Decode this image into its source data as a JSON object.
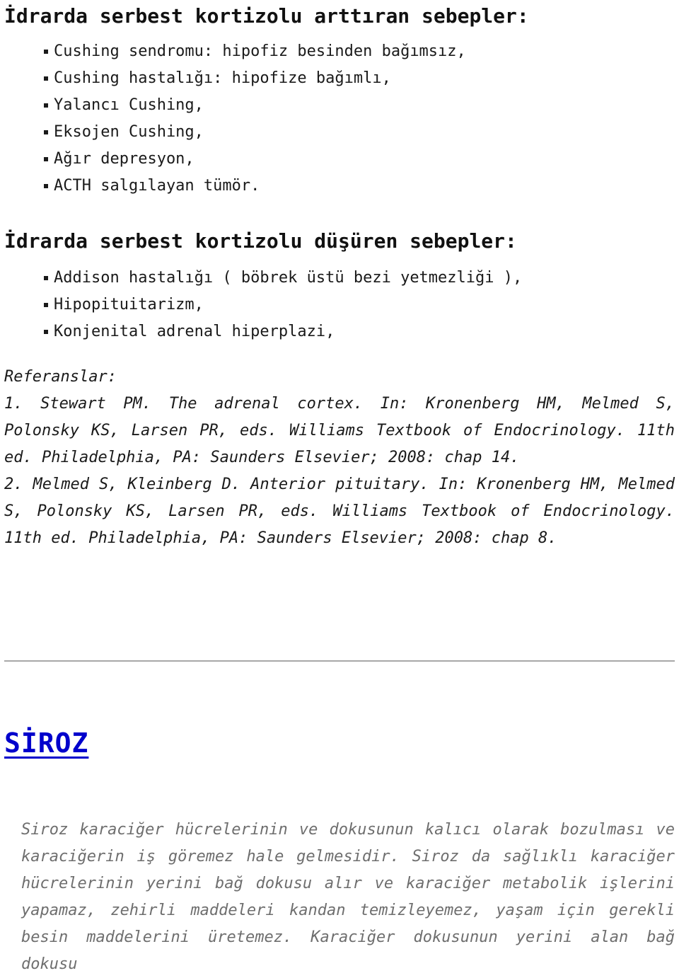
{
  "document": {
    "sections": {
      "raise": {
        "heading": "İdrarda serbest kortizolu arttıran sebepler:",
        "items": [
          "Cushing sendromu: hipofiz besinden bağımsız,",
          "Cushing hastalığı: hipofize bağımlı,",
          "Yalancı Cushing,",
          "Eksojen Cushing,",
          "Ağır depresyon,",
          "ACTH salgılayan tümör."
        ]
      },
      "lower": {
        "heading": "İdrarda serbest kortizolu düşüren sebepler:",
        "items": [
          "Addison hastalığı ( böbrek üstü bezi yetmezliği ),",
          "Hipopituitarizm,",
          "Konjenital adrenal hiperplazi,"
        ]
      },
      "references": {
        "label": "Referanslar:",
        "items": [
          "1. Stewart PM. The adrenal cortex. In: Kronenberg HM, Melmed S, Polonsky KS, Larsen PR, eds. Williams Textbook of Endocrinology. 11th ed. Philadelphia, PA: Saunders Elsevier; 2008: chap 14.",
          "2. Melmed S, Kleinberg D. Anterior pituitary. In: Kronenberg HM, Melmed S, Polonsky KS, Larsen PR, eds. Williams Textbook of Endocrinology. 11th ed. Philadelphia, PA: Saunders Elsevier; 2008: chap 8."
        ]
      },
      "siroz": {
        "title": "SİROZ",
        "body": "Siroz karaciğer hücrelerinin ve dokusunun kalıcı olarak bozulması ve karaciğerin iş göremez hale gelmesidir. Siroz da sağlıklı karaciğer hücrelerinin yerini bağ dokusu alır ve karaciğer metabolik işlerini yapamaz, zehirli maddeleri kandan temizleyemez, yaşam için gerekli besin maddelerini üretemez. Karaciğer dokusunun yerini alan bağ dokusu"
      }
    }
  },
  "colors": {
    "text": "#1a1a1a",
    "link_heading": "#0000cc",
    "muted_body": "#6e6e6e",
    "divider": "#a8a8a8",
    "background": "#ffffff"
  }
}
